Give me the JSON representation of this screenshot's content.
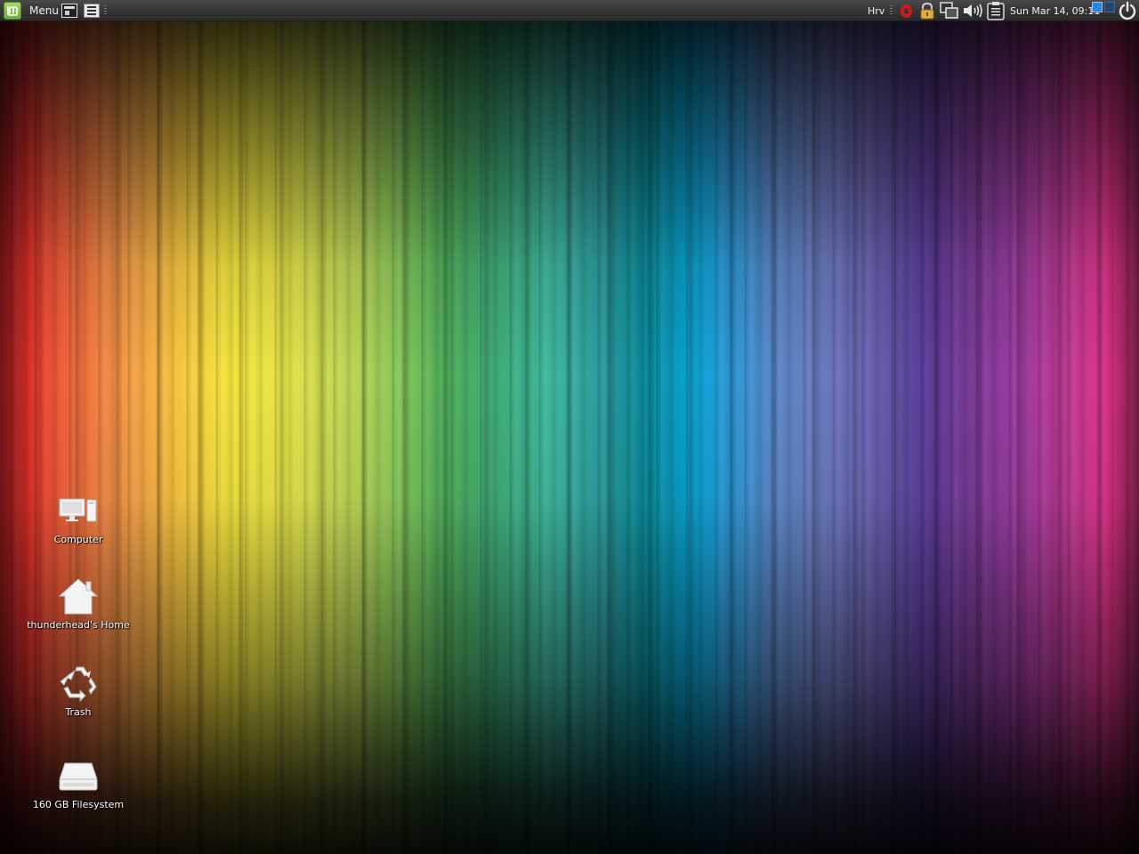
{
  "panel": {
    "menu_label": "Menu",
    "keyboard_layout": "Hrv",
    "clock": "Sun Mar 14, 09:11"
  },
  "desktop": {
    "icons": [
      {
        "label": "Computer",
        "icon": "computer-icon"
      },
      {
        "label": "thunderhead's Home",
        "icon": "home-folder-icon"
      },
      {
        "label": "Trash",
        "icon": "trash-icon"
      },
      {
        "label": "160 GB Filesystem",
        "icon": "drive-icon"
      }
    ]
  },
  "colors": {
    "panel_bg": "#383838",
    "mint_green": "#8cc152",
    "workspace_active": "#2a84d8",
    "opera_red": "#d01818"
  }
}
